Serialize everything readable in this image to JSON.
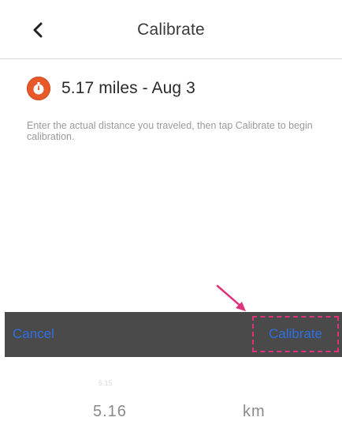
{
  "header": {
    "title": "Calibrate",
    "back_icon": "chevron-left-icon"
  },
  "activity": {
    "icon": "stopwatch-icon",
    "icon_color": "#e8592a",
    "title": "5.17 miles - Aug 3"
  },
  "instructions": "Enter the actual distance you traveled, then tap Calibrate to begin calibration.",
  "toolbar": {
    "cancel_label": "Cancel",
    "calibrate_label": "Calibrate",
    "button_color": "#2f6fe0",
    "background": "#4a4a4a",
    "highlight_color": "#e0327a"
  },
  "picker": {
    "faded_value": "5.15",
    "selected_value": "5.16",
    "unit": "km"
  }
}
